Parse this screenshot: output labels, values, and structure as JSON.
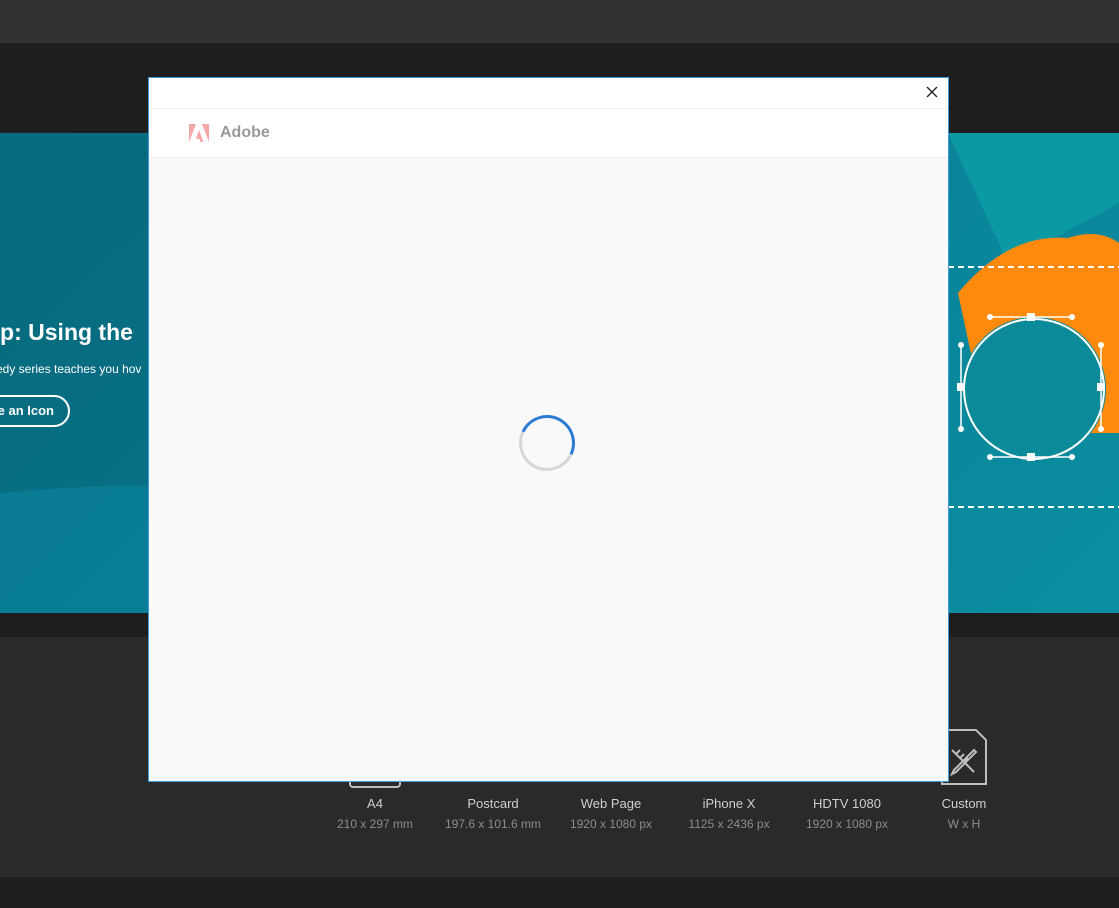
{
  "hero": {
    "title": "up: Using the",
    "subtitle": "edy series teaches you hov",
    "button_label": "e an Icon"
  },
  "presets": [
    {
      "name": "A4",
      "size": "210 x 297 mm"
    },
    {
      "name": "Postcard",
      "size": "197.6 x 101.6 mm"
    },
    {
      "name": "Web Page",
      "size": "1920 x 1080 px"
    },
    {
      "name": "iPhone X",
      "size": "1125 x 2436 px"
    },
    {
      "name": "HDTV 1080",
      "size": "1920 x 1080 px"
    },
    {
      "name": "Custom",
      "size": "W x H"
    }
  ],
  "modal": {
    "brand": "Adobe",
    "state": "loading",
    "close_icon": "close-icon"
  },
  "colors": {
    "hero_teal": "#0b8098",
    "accent_orange": "#ff8a0d",
    "spinner_blue": "#2b7bd3",
    "adobe_logo": "#f4a7a7"
  }
}
